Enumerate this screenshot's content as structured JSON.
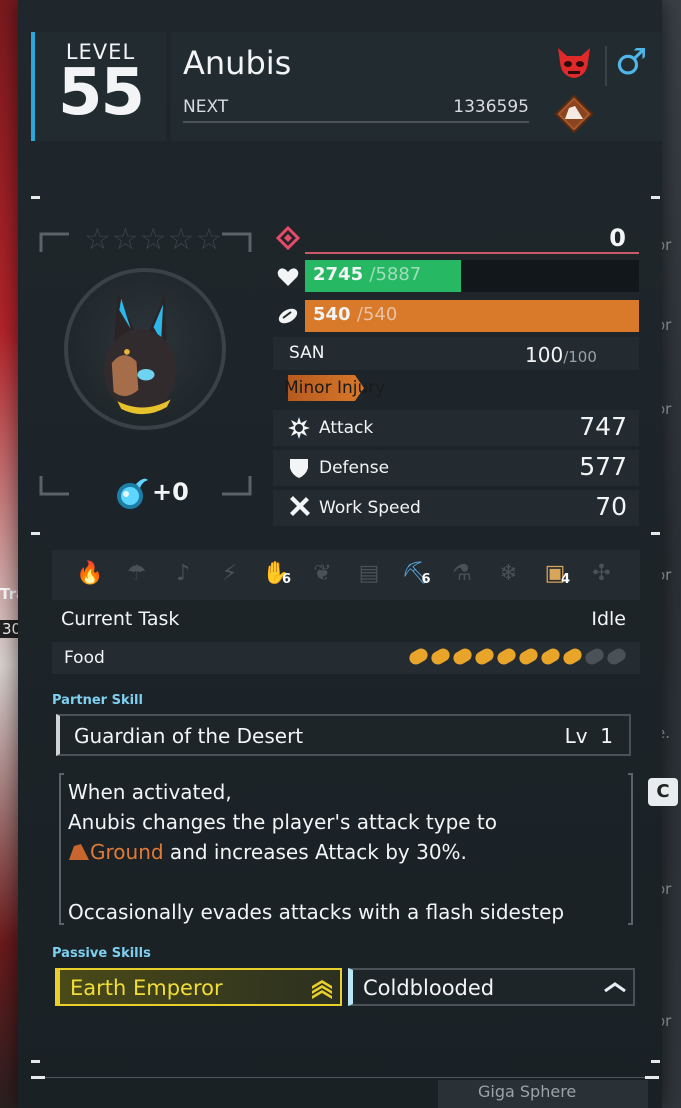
{
  "background": {
    "left_texts": [
      "Tra",
      "30"
    ],
    "right_texts": [
      "or",
      "or",
      "or",
      "or",
      "e.",
      "C",
      "or",
      "or"
    ],
    "bottom_text": "Giga Sphere"
  },
  "header": {
    "level_label": "LEVEL",
    "level": "55",
    "name": "Anubis",
    "next_label": "NEXT",
    "next_value": "1336595",
    "gender_symbol": "♂",
    "element": "ground-icon"
  },
  "portrait": {
    "rarity_stars": 5,
    "stars_filled": 0,
    "condenser_value": "+0"
  },
  "stats": {
    "trust": "0",
    "hp_current": "2745",
    "hp_max": "/5887",
    "hp_fraction": 0.466,
    "stomach_current": "540",
    "stomach_max": "/540",
    "stomach_fraction": 1.0,
    "san_label": "SAN",
    "san_current": "100",
    "san_max": "/100",
    "status": "Minor Injury",
    "attack_label": "Attack",
    "attack": "747",
    "defense_label": "Defense",
    "defense": "577",
    "work_speed_label": "Work Speed",
    "work_speed": "70"
  },
  "work_suitability": [
    {
      "icon": "kindling-icon",
      "level": ""
    },
    {
      "icon": "watering-icon",
      "level": ""
    },
    {
      "icon": "planting-icon",
      "level": ""
    },
    {
      "icon": "electricity-icon",
      "level": ""
    },
    {
      "icon": "handiwork-icon",
      "level": "6",
      "active": true
    },
    {
      "icon": "gathering-icon",
      "level": ""
    },
    {
      "icon": "lumbering-icon",
      "level": ""
    },
    {
      "icon": "mining-icon",
      "level": "6",
      "active": true
    },
    {
      "icon": "medicine-icon",
      "level": ""
    },
    {
      "icon": "cooling-icon",
      "level": ""
    },
    {
      "icon": "transporting-icon",
      "level": "4",
      "active": true
    },
    {
      "icon": "farming-icon",
      "level": ""
    }
  ],
  "task": {
    "label": "Current Task",
    "value": "Idle"
  },
  "food": {
    "label": "Food",
    "filled": 8,
    "total": 10
  },
  "partner_skill": {
    "section_label": "Partner Skill",
    "name": "Guardian of the Desert",
    "lv_label": "Lv",
    "lv": "1",
    "desc_line1": "When activated,",
    "desc_line2": "Anubis changes the player's attack type to",
    "desc_element": "Ground",
    "desc_line3_rest": " and increases Attack by 30%.",
    "desc_line4": "Occasionally evades attacks with a flash sidestep",
    "key_hint": "C"
  },
  "passive": {
    "section_label": "Passive Skills",
    "skills": [
      {
        "name": "Earth Emperor",
        "rank": "legendary"
      },
      {
        "name": "Coldblooded",
        "rank": "positive"
      }
    ]
  },
  "colors": {
    "accent_blue": "#2ea7d8",
    "hp_green": "#27b864",
    "stomach_orange": "#d9792a",
    "ground_brown": "#a85a2c",
    "legendary_gold": "#e8cf2a"
  }
}
